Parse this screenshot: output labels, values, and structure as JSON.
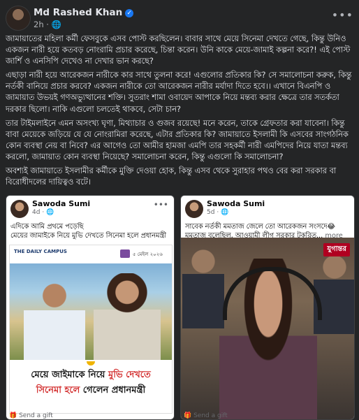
{
  "post": {
    "author": "Md Rashed Khan",
    "time": "2h",
    "privacy_icon": "globe-icon",
    "paragraphs": [
      "জামায়াতের মহিলা কর্মী ফেসবুকে এসব পোস্ট করছিলেন। বাবার সাথে মেয়ে সিনেমা দেখতে গেছে, কিন্তু উনিও একজন নারী হয়ে কতবড় নোংরামি প্রচার করেছে, চিন্তা করেন। উনি কাকে মেয়ে-জামাই কল্পনা করে?! এই পোস্ট জার্শি ও এনসিপি দেখেও না দেখার ভান করছে?",
      "এছাড়া নারী হয়ে আরেকজন নারীকে কার সাথে তুলনা করে! এগুলোর প্রতিকার কি? সে সমালোচনা করুক, কিন্তু নর্তকী বানিয়ে প্রচার করবে? একজন নারীকে তো আরেকজন নারীর মর্যাদা দিতে হবে।। এখানে বিএনপি ও জামায়াত উভয়ই গণঅভ্যুত্থানের শক্তি। সুতরাং শামা ওবায়েদ আপাকে নিয়ে মন্তব্য করার ক্ষেত্রে তার সতর্কতা দরকার ছিলো। নাকি এগুলো চলতেই থাকবে, সেটা চান?",
      "তার টাইমলাইনে এমন অসংখ্য ঘৃণা, মিথ্যাচার ও গুজব রয়েছে! মনে করেন, তাকে গ্রেফতার করা যাবেনা। কিন্তু বাবা মেয়েকে জড়িয়ে যে যে নোংরামিরা করেছে, এটার প্রতিকার কি? জামায়াতে ইসলামী কি এসবের সাংগঠনিক কোন ব্যবস্থা নেয় বা নিবে? এর আগেও তো আমীর হামজা এমপি তার সহকর্মী নারী এমপিদের নিয়ে যাতা মন্তব্য করলো, জামায়াত কোন ব্যবস্থা নিয়েছে? সমালোচনা করেন, কিন্তু এগুলো কি সমালোচনা?",
      "অবশ্যই জামায়াতে ইসলামীর কর্মীকে মুক্তি দেওয়া হোক, কিন্তু এসব থেকে সুরাহার পথও বের করা সরকার বা বিরোধীদলের দায়িত্বও বটে।"
    ]
  },
  "shared_left": {
    "author": "Sawoda Sumi",
    "time": "4d",
    "text": "এদিকে আমি প্রথমে পড়েছি\nমেয়ের জামাইকে নিয়ে মুভি দেখতে সিনেমা হলে প্রধানমন্ত্রী",
    "source": "THE DAILY CAMPUS",
    "date": "৫ মেইল ২০২৬",
    "headline_1_black": "মেয়ে জাইমাকে নিয়ে ",
    "headline_1_red": "মুভি দেখতে",
    "headline_2_red": "সিনেমা হলে ",
    "headline_2_black": "গেলেন প্রধানমন্ত্রী",
    "gift": "Send a gift"
  },
  "shared_right": {
    "author": "Sawoda Sumi",
    "time": "5d",
    "text": "সাবেক নর্তকী মমতাজ জেলে তো আরেকজন সংসদে😂\nমমতাজ বলেছিল, আওয়ামী লীগ সরকার টুকরিত...",
    "see_more": "more",
    "watermark": "যুগান্তর",
    "gift": "Send a gift"
  },
  "colors": {
    "bg": "#242526",
    "text": "#e4e6eb",
    "muted": "#b0b3b8",
    "verified": "#1877f2",
    "red": "#d32f2f"
  }
}
